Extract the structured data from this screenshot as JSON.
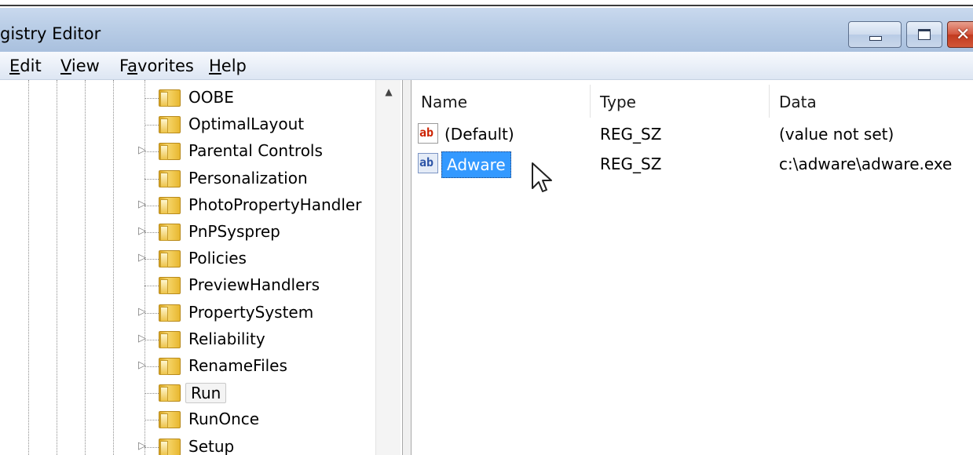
{
  "window": {
    "title": "gistry Editor",
    "minimize_icon": "minimize-icon",
    "maximize_icon": "maximize-icon",
    "close_icon": "close-icon"
  },
  "menu": {
    "items": [
      {
        "label": "Edit",
        "underline": "E",
        "rest": "dit"
      },
      {
        "label": "View",
        "underline": "V",
        "rest": "iew"
      },
      {
        "label": "Favorites",
        "pre": "F",
        "underline": "a",
        "rest": "vorites"
      },
      {
        "label": "Help",
        "underline": "H",
        "rest": "elp"
      }
    ]
  },
  "tree": {
    "items": [
      {
        "label": "OOBE",
        "expandable": false
      },
      {
        "label": "OptimalLayout",
        "expandable": false
      },
      {
        "label": "Parental Controls",
        "expandable": true
      },
      {
        "label": "Personalization",
        "expandable": false
      },
      {
        "label": "PhotoPropertyHandler",
        "expandable": true
      },
      {
        "label": "PnPSysprep",
        "expandable": true
      },
      {
        "label": "Policies",
        "expandable": true
      },
      {
        "label": "PreviewHandlers",
        "expandable": false
      },
      {
        "label": "PropertySystem",
        "expandable": true
      },
      {
        "label": "Reliability",
        "expandable": true
      },
      {
        "label": "RenameFiles",
        "expandable": true
      },
      {
        "label": "Run",
        "expandable": false,
        "selected": true
      },
      {
        "label": "RunOnce",
        "expandable": false
      },
      {
        "label": "Setup",
        "expandable": true
      }
    ]
  },
  "list": {
    "columns": [
      "Name",
      "Type",
      "Data"
    ],
    "rows": [
      {
        "name": "(Default)",
        "type": "REG_SZ",
        "data": "(value not set)",
        "icon": "ab-string-icon"
      },
      {
        "name": "Adware",
        "type": "REG_SZ",
        "data": "c:\\adware\\adware.exe",
        "icon": "ab-string-icon",
        "selected": true
      }
    ],
    "icon_glyph": "ab"
  }
}
